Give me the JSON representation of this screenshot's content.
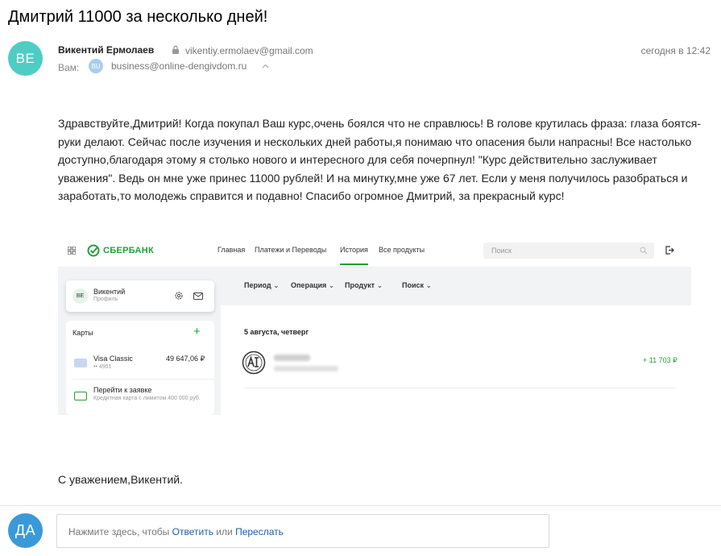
{
  "subject": "Дмитрий 11000 за несколько дней!",
  "sender": {
    "initials": "ВЕ",
    "name": "Викентий Ермолаев",
    "email": "vikentiy.ermolaev@gmail.com",
    "date": "сегодня в 12:42",
    "avatar_color": "#4ecdc4"
  },
  "recipient": {
    "label": "Вам:",
    "initials": "BU",
    "email": "business@online-dengivdom.ru"
  },
  "body": "Здравствуйте,Дмитрий! Когда покупал Ваш курс,очень боялся что не справлюсь! В голове крутилась фраза: глаза боятся-руки делают. Сейчас после изучения и нескольких дней работы,я понимаю что опасения были напрасны! Все настолько доступно,благодаря этому я столько нового и интересного для себя почерпнул! \"Курс действительно заслуживает уважения\". Ведь он мне уже принес 11000 рублей! И на минутку,мне уже 67 лет. Если у меня получилось разобраться и заработать,то молодежь справится и подавно! Спасибо огромное Дмитрий, за прекрасный курс!",
  "signature": "С уважением,Викентий.",
  "reply": {
    "initials": "ДА",
    "prefix": "Нажмите здесь, чтобы",
    "reply_link": "Ответить",
    "or": "или",
    "forward_link": "Переслать",
    "avatar_color": "#3a9ad9"
  },
  "screenshot": {
    "brand": "СБЕРБАНК",
    "brand_color": "#21a038",
    "nav": [
      "Главная",
      "Платежи и Переводы",
      "История",
      "Все продукты"
    ],
    "active_nav": "История",
    "search_placeholder": "Поиск",
    "filters": [
      "Период",
      "Операция",
      "Продукт",
      "Поиск"
    ],
    "profile": {
      "initials": "ВЕ",
      "name": "Викентий",
      "sub": "Профиль"
    },
    "cards_title": "Карты",
    "card": {
      "name": "Visa Classic",
      "number": "•• 4951",
      "balance": "49 647,06 ₽"
    },
    "apply": {
      "title": "Перейти к заявке",
      "desc": "Кредитная карта с лимитом 400 000 руб."
    },
    "date_heading": "5 августа, четверг",
    "transaction": {
      "amount": "+ 11 703 ₽"
    }
  }
}
